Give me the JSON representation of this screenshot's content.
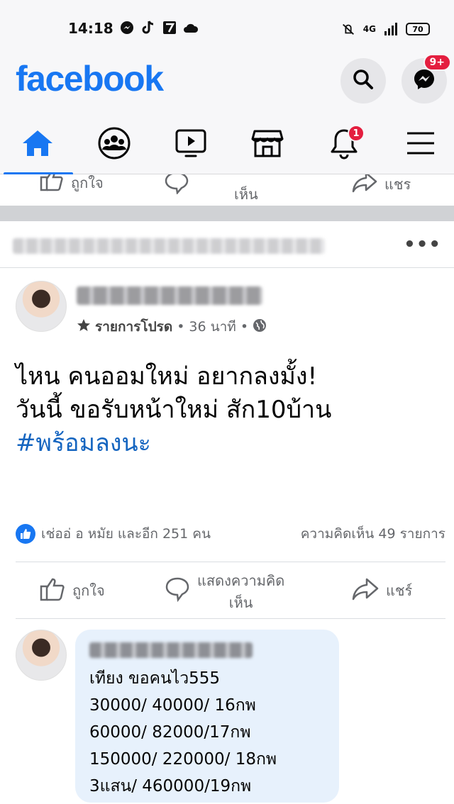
{
  "status_bar": {
    "time": "14:18",
    "network": "4G",
    "battery": "70"
  },
  "header": {
    "logo": "facebook",
    "messenger_badge": "9+"
  },
  "nav": {
    "notifications_badge": "1"
  },
  "previous_post_actions": {
    "like": "ถูกใจ",
    "comment": "เห็น",
    "share": "แชร"
  },
  "post": {
    "meta_favorites": "รายการโปรด",
    "time": "36 นาที",
    "text_lines": [
      "ไหน คนออมใหม่ อยากลงมั้ง!",
      "วันนี้ ขอรับหน้าใหม่ สัก10บ้าน"
    ],
    "hashtag": "#พร้อมลงนะ",
    "reactions_text": "เช่ออ่ อ หมัย และอีก 251 คน",
    "comments_count": "ความคิดเห็น 49 รายการ",
    "actions": {
      "like": "ถูกใจ",
      "comment_line1": "แสดงความคิด",
      "comment_line2": "เห็น",
      "share": "แชร์"
    }
  },
  "comment": {
    "lines": [
      "เทียง ขอคนไว555",
      "30000/ 40000/ 16กพ",
      "60000/ 82000/17กพ",
      "150000/ 220000/ 18กพ",
      "3แสน/ 460000/19กพ"
    ]
  },
  "colors": {
    "brand": "#1877f2",
    "badge": "#e41e3f",
    "hashtag": "#1565c0",
    "comment_bubble": "#e7f1fc"
  }
}
